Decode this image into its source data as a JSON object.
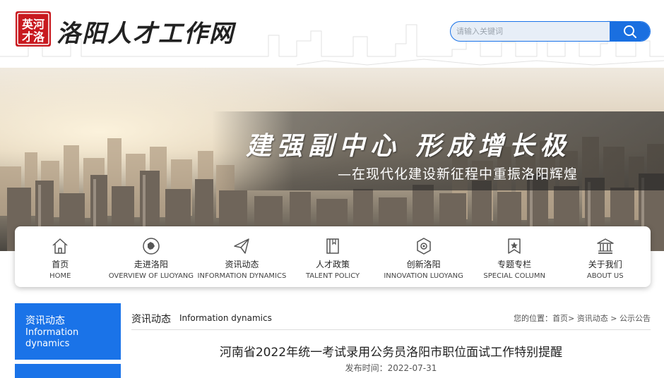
{
  "header": {
    "logo_seal_text": "英河才洛",
    "site_name": "洛阳人才工作网",
    "search_placeholder": "请输入关键词"
  },
  "banner": {
    "title": "建强副中心  形成增长极",
    "subtitle": "—在现代化建设新征程中重振洛阳辉煌"
  },
  "nav": [
    {
      "cn": "首页",
      "en": "HOME",
      "icon": "home-icon"
    },
    {
      "cn": "走进洛阳",
      "en": "OVERVIEW OF LUOYANG",
      "icon": "map-icon"
    },
    {
      "cn": "资讯动态",
      "en": "INFORMATION DYNAMICS",
      "icon": "paper-plane-icon"
    },
    {
      "cn": "人才政策",
      "en": "TALENT POLICY",
      "icon": "book-icon"
    },
    {
      "cn": "创新洛阳",
      "en": "INNOVATION LUOYANG",
      "icon": "innovation-icon"
    },
    {
      "cn": "专题专栏",
      "en": "SPECIAL COLUMN",
      "icon": "star-badge-icon"
    },
    {
      "cn": "关于我们",
      "en": "ABOUT US",
      "icon": "building-icon"
    }
  ],
  "sidebar": {
    "active_cn": "资讯动态",
    "active_en_line1": "Information",
    "active_en_line2": "dynamics"
  },
  "content": {
    "section_cn": "资讯动态",
    "section_en": "Information dynamics",
    "breadcrumb": {
      "prefix": "您的位置：",
      "home": "首页",
      "sep1": "> ",
      "section": "资讯动态",
      "sep2": " > ",
      "current": "公示公告"
    },
    "article_title": "河南省2022年统一考试录用公务员洛阳市职位面试工作特别提醒",
    "publish_label": "发布时间：",
    "publish_date": "2022-07-31"
  },
  "colors": {
    "accent": "#1a73e8",
    "seal": "#c8191f"
  }
}
